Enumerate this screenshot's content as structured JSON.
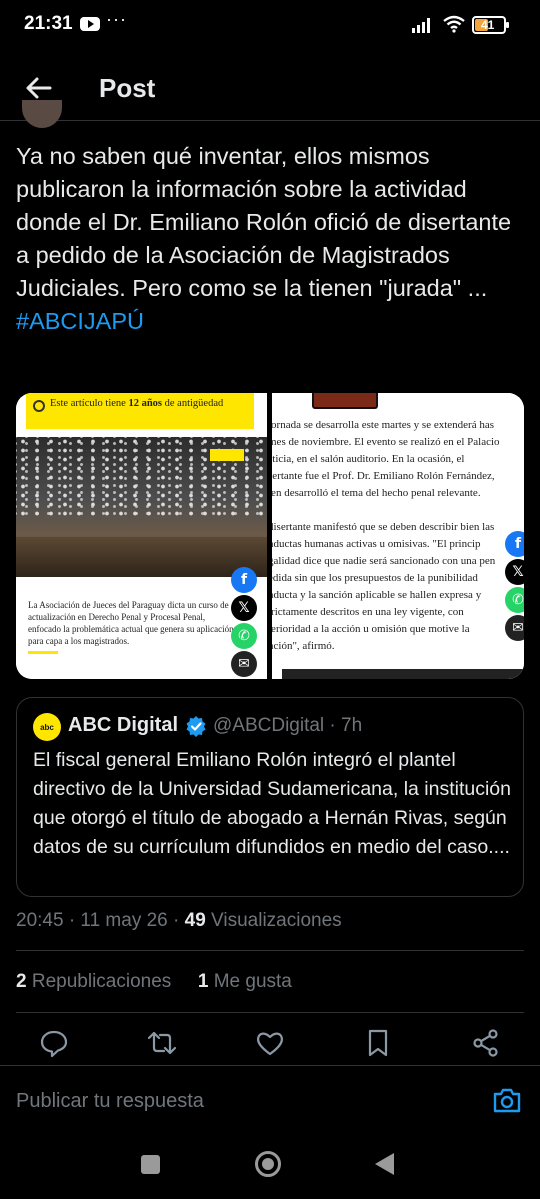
{
  "status_bar": {
    "time": "21:31",
    "dots": "···",
    "battery": "41",
    "icons": [
      "youtube-icon",
      "signal-icon",
      "wifi-icon",
      "battery-icon"
    ]
  },
  "header": {
    "title": "Post",
    "back_icon": "arrow-left-icon"
  },
  "tweet": {
    "text": "Ya no saben qué inventar, ellos mismos publicaron la información sobre la actividad donde el Dr. Emiliano Rolón ofició de disertante a pedido de la Asociación de Magistrados Judiciales. Pero como se la tienen \"jurada\" ...",
    "hashtag": "#ABCIJAPÚ"
  },
  "media": {
    "left": {
      "banner_text": "Este artículo tiene ",
      "banner_bold": "12 años",
      "banner_text_2": " de antigüedad",
      "caption": "La Asociación de Jueces del Paraguay dicta un curso de actualización en Derecho Penal y Procesal Penal, enfocado la problemática actual que genera su aplicación, para capa a los magistrados."
    },
    "right": {
      "paragraph_1": [
        "jornada se desarrolla este martes y se extenderá has",
        "mes de noviembre. El evento se realizó en el Palacio",
        "sticia, en el salón auditorio. En la ocasión, el",
        "sertante fue el Prof. Dr. Emiliano Rolón Fernández,",
        "ien desarrolló el tema del hecho penal relevante."
      ],
      "paragraph_2": [
        "disertante manifestó que se deben describir bien las",
        "nductas humanas activas u omisivas. \"El princip",
        "galidad dice que nadie será sancionado con una pen",
        "edida sin que los presupuestos de la punibilidad",
        "nducta y la sanción aplicable se hallen expresa y",
        "tricta­mente descritos en una ley vigente, con",
        "terioridad a la acción u omisión que motive la",
        "nción\", afirmó."
      ]
    },
    "share_icons": [
      "facebook-icon",
      "x-icon",
      "whatsapp-icon",
      "mail-icon"
    ],
    "share_colors": {
      "facebook": "#1877f2",
      "whatsapp": "#25d366"
    }
  },
  "quote": {
    "avatar_text": "abc",
    "name": "ABC Digital",
    "handle": "@ABCDigital · 7h",
    "text": "El fiscal general Emiliano Rolón integró el plantel directivo de la Universidad Sudamericana, la institución que otorgó el título de abogado a Hernán Rivas, según datos de su currículum difundidos en medio del caso...."
  },
  "meta": {
    "time": "20:45 · 11 may 26 · ",
    "views_count": "49",
    "views_label": " Visualizaciones"
  },
  "stats": {
    "reposts_count": "2",
    "reposts_label": " Republicaciones",
    "likes_count": "1",
    "likes_label": " Me gusta"
  },
  "actions": [
    "reply-icon",
    "repost-icon",
    "like-icon",
    "bookmark-icon",
    "share-icon"
  ],
  "reply_bar": {
    "placeholder": "Publicar tu respuesta"
  },
  "colors": {
    "accent": "#1d9bf0",
    "muted": "#71767b",
    "abc_yellow": "#ffe600"
  }
}
